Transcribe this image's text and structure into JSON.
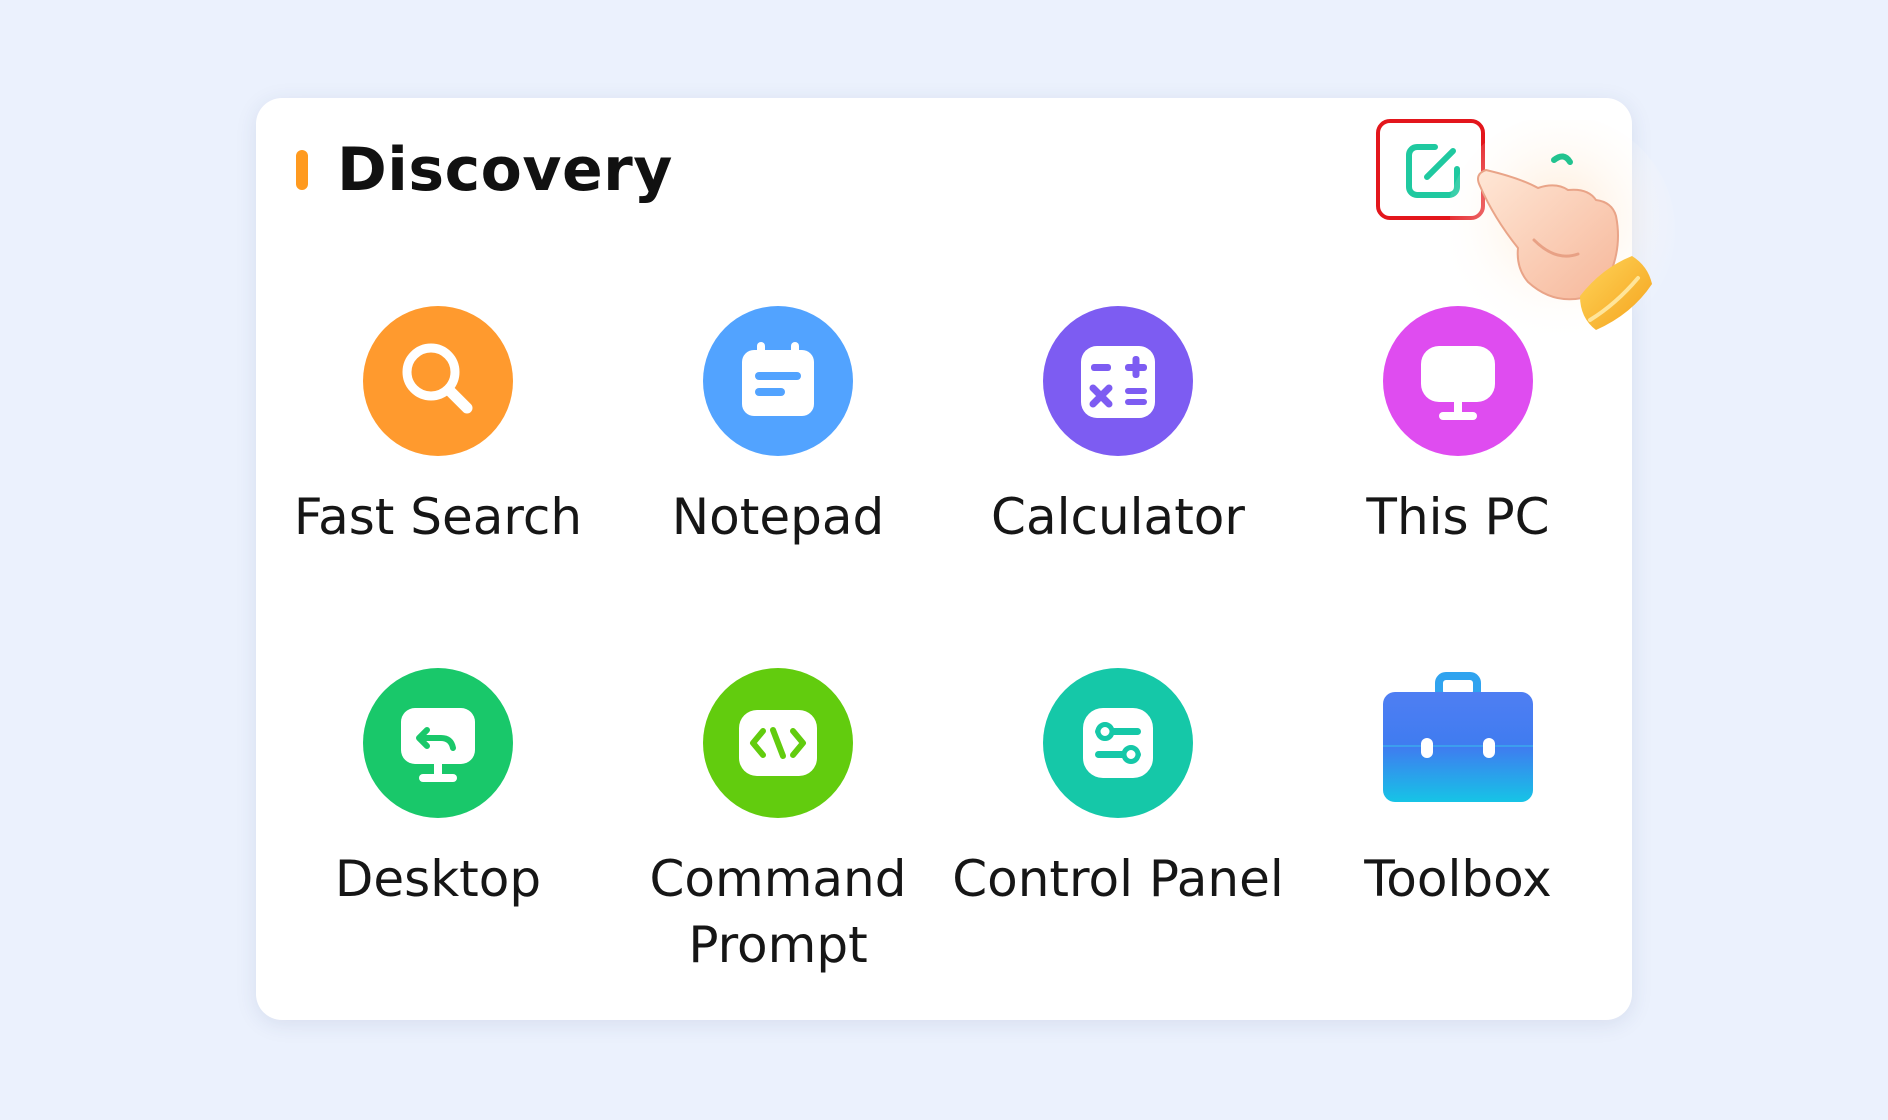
{
  "header": {
    "title": "Discovery",
    "edit_icon": "edit-square-icon"
  },
  "colors": {
    "page_background": "#ebf1fd",
    "accent_bar": "#ff9a1f",
    "highlight_border": "#e3161c",
    "edit_icon": "#1fc9a0"
  },
  "apps": [
    {
      "label": "Fast Search",
      "icon": "magnifier-icon",
      "color": "#ff9a2e"
    },
    {
      "label": "Notepad",
      "icon": "notepad-icon",
      "color": "#52a3ff"
    },
    {
      "label": "Calculator",
      "icon": "calculator-icon",
      "color": "#7d5cf2"
    },
    {
      "label": "This PC",
      "icon": "monitor-icon",
      "color": "#df4cf0"
    },
    {
      "label": "Desktop",
      "icon": "desktop-return-icon",
      "color": "#19c86a"
    },
    {
      "label": "Command Prompt",
      "icon": "code-brackets-icon",
      "color": "#62cc0e"
    },
    {
      "label": "Control Panel",
      "icon": "settings-sliders-icon",
      "color": "#15c8a8"
    },
    {
      "label": "Toolbox",
      "icon": "toolbox-icon",
      "color": "#3d8cf0"
    }
  ]
}
